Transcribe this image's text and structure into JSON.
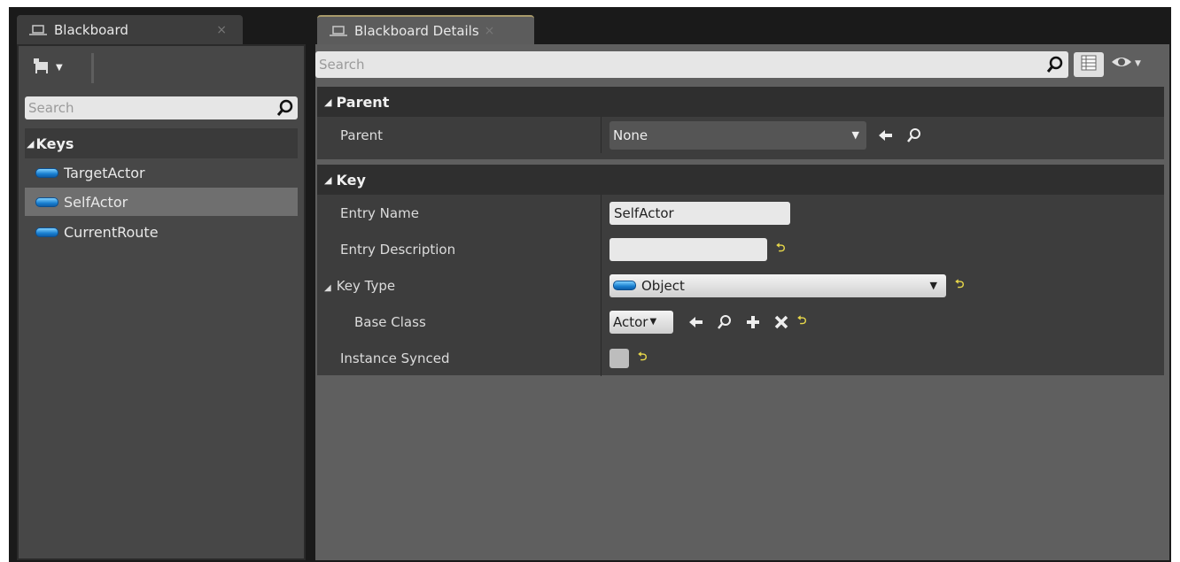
{
  "tabs": {
    "blackboard": {
      "label": "Blackboard",
      "close": "×"
    },
    "details": {
      "label": "Blackboard Details",
      "close": "×"
    }
  },
  "left": {
    "search_placeholder": "Search",
    "keys_header": "Keys",
    "keys": [
      {
        "label": "TargetActor",
        "selected": false
      },
      {
        "label": "SelfActor",
        "selected": true
      },
      {
        "label": "CurrentRoute",
        "selected": false
      }
    ]
  },
  "right": {
    "search_placeholder": "Search",
    "sections": {
      "parent": {
        "header": "Parent",
        "rows": {
          "parent": {
            "label": "Parent",
            "value": "None"
          }
        }
      },
      "key": {
        "header": "Key",
        "rows": {
          "entry_name": {
            "label": "Entry Name",
            "value": "SelfActor"
          },
          "entry_description": {
            "label": "Entry Description",
            "value": ""
          },
          "key_type": {
            "label": "Key Type",
            "value": "Object"
          },
          "base_class": {
            "label": "Base Class",
            "value": "Actor"
          },
          "instance_synced": {
            "label": "Instance Synced",
            "checked": false
          }
        }
      }
    }
  },
  "icons": {
    "search": "search-icon",
    "reset": "reset-to-default-icon",
    "use_selected": "arrow-left-icon",
    "browse": "browse-icon",
    "add": "plus-icon",
    "clear": "close-icon"
  },
  "colors": {
    "key_pill": "#1a7fd0",
    "reset_arrow": "#e8d84a",
    "selected_row": "#6f6f6f"
  }
}
